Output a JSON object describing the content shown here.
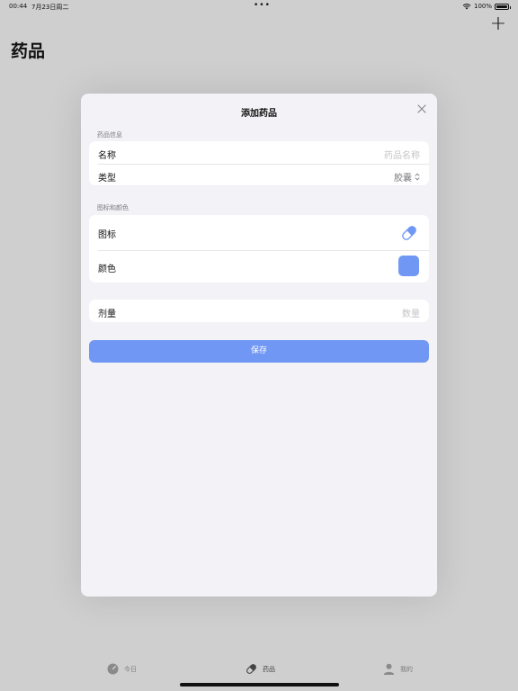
{
  "status": {
    "time": "00:44",
    "date": "7月23日周二",
    "dots": "•••",
    "battery": "100%"
  },
  "header": {
    "title": "药品",
    "add_label": "+"
  },
  "modal": {
    "title": "添加药品",
    "section_info": {
      "header": "药品信息",
      "name_label": "名称",
      "name_placeholder": "药品名称",
      "type_label": "类型",
      "type_value": "胶囊"
    },
    "section_icon": {
      "header": "图标和颜色",
      "icon_label": "图标",
      "icon_name": "capsule-icon",
      "color_label": "颜色",
      "color_value": "#7097f4"
    },
    "section_dose": {
      "dose_label": "剂量",
      "dose_placeholder": "数量"
    },
    "save_label": "保存",
    "accent": "#7097f4"
  },
  "tabs": [
    {
      "label": "今日",
      "icon": "gauge-icon"
    },
    {
      "label": "药品",
      "icon": "pill-icon",
      "selected": true
    },
    {
      "label": "我的",
      "icon": "person-icon"
    }
  ]
}
